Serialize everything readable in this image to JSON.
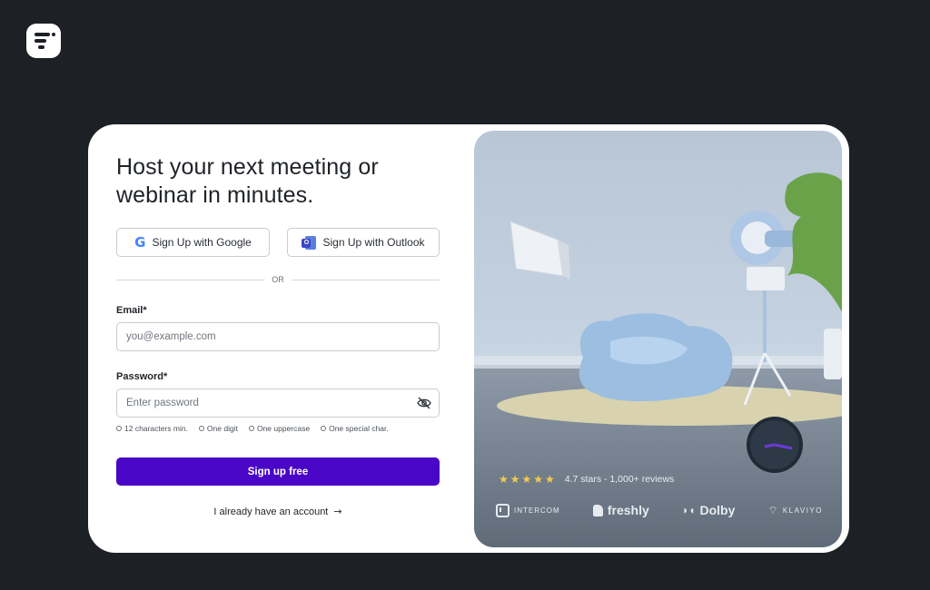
{
  "app": {
    "logo_icon": "app-logo-icon"
  },
  "card": {
    "title": "Host your next meeting or webinar in minutes.",
    "sso": {
      "google_label": "Sign Up with Google",
      "outlook_label": "Sign Up with Outlook"
    },
    "divider_text": "OR",
    "email": {
      "label": "Email*",
      "placeholder": "you@example.com",
      "value": ""
    },
    "password": {
      "label": "Password*",
      "placeholder": "Enter password",
      "value": ""
    },
    "requirements": [
      "12 characters min.",
      "One digit",
      "One uppercase",
      "One special char."
    ],
    "signup_label": "Sign up free",
    "login_label": "I already have an account",
    "accent_color": "#4a06c6"
  },
  "hero": {
    "stars": "★★★★★",
    "rating_text": "4.7 stars - 1,000+ reviews",
    "star_color": "#f3cb4f",
    "brands": [
      "INTERCOM",
      "freshly",
      "Dolby",
      "KLAVIYO"
    ]
  }
}
